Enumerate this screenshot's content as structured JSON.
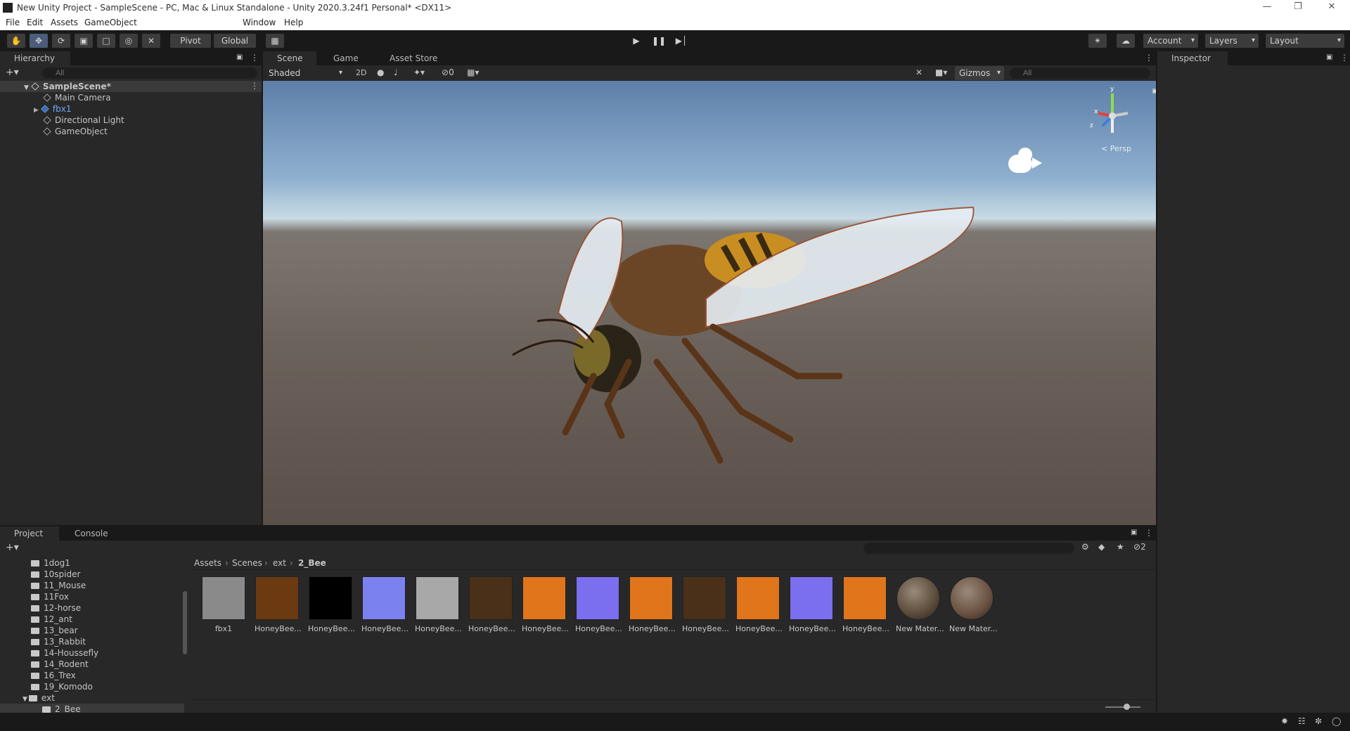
{
  "window": {
    "title": "New Unity Project - SampleScene - PC, Mac & Linux Standalone - Unity 2020.3.24f1 Personal* <DX11>"
  },
  "menu": [
    "File",
    "Edit",
    "Assets",
    "GameObject",
    "Window",
    "Help"
  ],
  "toolbar": {
    "pivot": "Pivot",
    "global": "Global",
    "account": "Account",
    "layers": "Layers",
    "layout": "Layout"
  },
  "hierarchy": {
    "tab": "Hierarchy",
    "search_placeholder": "All",
    "scene": "SampleScene*",
    "items": [
      "Main Camera",
      "fbx1",
      "Directional Light",
      "GameObject"
    ]
  },
  "scene_view": {
    "tabs": [
      "Scene",
      "Game",
      "Asset Store"
    ],
    "shading": "Shaded",
    "mode_2d": "2D",
    "hidden_count": "0",
    "gizmos": "Gizmos",
    "search_placeholder": "All",
    "persp_label": "< Persp",
    "axes": {
      "y": "y",
      "x": "x",
      "z": "z"
    }
  },
  "inspector": {
    "tab": "Inspector"
  },
  "project": {
    "tabs": [
      "Project",
      "Console"
    ],
    "folders": [
      "1dog1",
      "10spider",
      "11_Mouse",
      "11Fox",
      "12-horse",
      "12_ant",
      "13_bear",
      "13_Rabbit",
      "14-Houssefly",
      "14_Rodent",
      "16_Trex",
      "19_Komodo",
      "ext",
      "2_Bee"
    ],
    "breadcrumb": [
      "Assets",
      "Scenes",
      "ext",
      "2_Bee"
    ],
    "hidden_count": "2",
    "assets": [
      {
        "label": "fbx1",
        "color": "#8a8a8a"
      },
      {
        "label": "HoneyBee...",
        "color": "#6b3a10"
      },
      {
        "label": "HoneyBee...",
        "color": "#000000"
      },
      {
        "label": "HoneyBee...",
        "color": "#7b82f0"
      },
      {
        "label": "HoneyBee...",
        "color": "#a8a8a8"
      },
      {
        "label": "HoneyBee...",
        "color": "#4a3018"
      },
      {
        "label": "HoneyBee...",
        "color": "#e0751c"
      },
      {
        "label": "HoneyBee...",
        "color": "#7b6ff0"
      },
      {
        "label": "HoneyBee...",
        "color": "#e0751c"
      },
      {
        "label": "HoneyBee...",
        "color": "#4a3018"
      },
      {
        "label": "HoneyBee...",
        "color": "#e0751c"
      },
      {
        "label": "HoneyBee...",
        "color": "#7b6ff0"
      },
      {
        "label": "HoneyBee...",
        "color": "#e0751c"
      },
      {
        "label": "New Mater...",
        "color": "#5a4a3a"
      },
      {
        "label": "New Mater...",
        "color": "#6a5040"
      }
    ]
  }
}
